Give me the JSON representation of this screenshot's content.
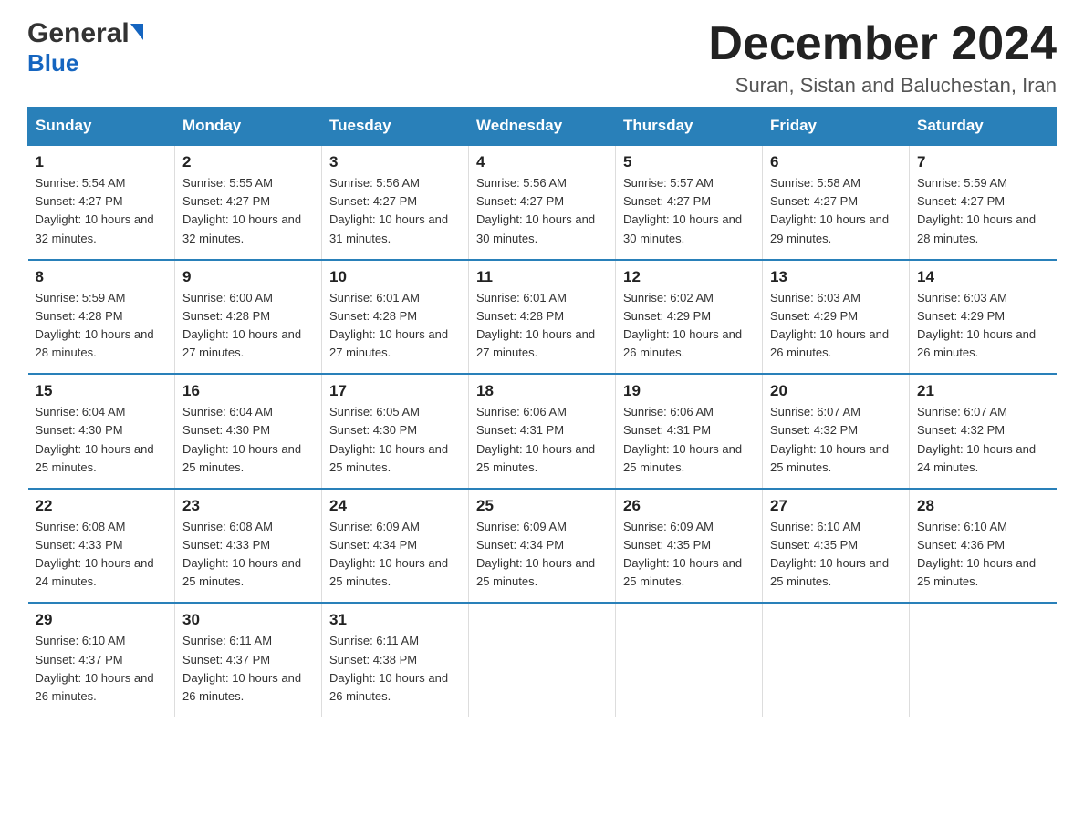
{
  "header": {
    "logo_general": "General",
    "logo_blue": "Blue",
    "month_title": "December 2024",
    "subtitle": "Suran, Sistan and Baluchestan, Iran"
  },
  "days_of_week": [
    "Sunday",
    "Monday",
    "Tuesday",
    "Wednesday",
    "Thursday",
    "Friday",
    "Saturday"
  ],
  "weeks": [
    [
      {
        "day": "1",
        "sunrise": "5:54 AM",
        "sunset": "4:27 PM",
        "daylight": "10 hours and 32 minutes."
      },
      {
        "day": "2",
        "sunrise": "5:55 AM",
        "sunset": "4:27 PM",
        "daylight": "10 hours and 32 minutes."
      },
      {
        "day": "3",
        "sunrise": "5:56 AM",
        "sunset": "4:27 PM",
        "daylight": "10 hours and 31 minutes."
      },
      {
        "day": "4",
        "sunrise": "5:56 AM",
        "sunset": "4:27 PM",
        "daylight": "10 hours and 30 minutes."
      },
      {
        "day": "5",
        "sunrise": "5:57 AM",
        "sunset": "4:27 PM",
        "daylight": "10 hours and 30 minutes."
      },
      {
        "day": "6",
        "sunrise": "5:58 AM",
        "sunset": "4:27 PM",
        "daylight": "10 hours and 29 minutes."
      },
      {
        "day": "7",
        "sunrise": "5:59 AM",
        "sunset": "4:27 PM",
        "daylight": "10 hours and 28 minutes."
      }
    ],
    [
      {
        "day": "8",
        "sunrise": "5:59 AM",
        "sunset": "4:28 PM",
        "daylight": "10 hours and 28 minutes."
      },
      {
        "day": "9",
        "sunrise": "6:00 AM",
        "sunset": "4:28 PM",
        "daylight": "10 hours and 27 minutes."
      },
      {
        "day": "10",
        "sunrise": "6:01 AM",
        "sunset": "4:28 PM",
        "daylight": "10 hours and 27 minutes."
      },
      {
        "day": "11",
        "sunrise": "6:01 AM",
        "sunset": "4:28 PM",
        "daylight": "10 hours and 27 minutes."
      },
      {
        "day": "12",
        "sunrise": "6:02 AM",
        "sunset": "4:29 PM",
        "daylight": "10 hours and 26 minutes."
      },
      {
        "day": "13",
        "sunrise": "6:03 AM",
        "sunset": "4:29 PM",
        "daylight": "10 hours and 26 minutes."
      },
      {
        "day": "14",
        "sunrise": "6:03 AM",
        "sunset": "4:29 PM",
        "daylight": "10 hours and 26 minutes."
      }
    ],
    [
      {
        "day": "15",
        "sunrise": "6:04 AM",
        "sunset": "4:30 PM",
        "daylight": "10 hours and 25 minutes."
      },
      {
        "day": "16",
        "sunrise": "6:04 AM",
        "sunset": "4:30 PM",
        "daylight": "10 hours and 25 minutes."
      },
      {
        "day": "17",
        "sunrise": "6:05 AM",
        "sunset": "4:30 PM",
        "daylight": "10 hours and 25 minutes."
      },
      {
        "day": "18",
        "sunrise": "6:06 AM",
        "sunset": "4:31 PM",
        "daylight": "10 hours and 25 minutes."
      },
      {
        "day": "19",
        "sunrise": "6:06 AM",
        "sunset": "4:31 PM",
        "daylight": "10 hours and 25 minutes."
      },
      {
        "day": "20",
        "sunrise": "6:07 AM",
        "sunset": "4:32 PM",
        "daylight": "10 hours and 25 minutes."
      },
      {
        "day": "21",
        "sunrise": "6:07 AM",
        "sunset": "4:32 PM",
        "daylight": "10 hours and 24 minutes."
      }
    ],
    [
      {
        "day": "22",
        "sunrise": "6:08 AM",
        "sunset": "4:33 PM",
        "daylight": "10 hours and 24 minutes."
      },
      {
        "day": "23",
        "sunrise": "6:08 AM",
        "sunset": "4:33 PM",
        "daylight": "10 hours and 25 minutes."
      },
      {
        "day": "24",
        "sunrise": "6:09 AM",
        "sunset": "4:34 PM",
        "daylight": "10 hours and 25 minutes."
      },
      {
        "day": "25",
        "sunrise": "6:09 AM",
        "sunset": "4:34 PM",
        "daylight": "10 hours and 25 minutes."
      },
      {
        "day": "26",
        "sunrise": "6:09 AM",
        "sunset": "4:35 PM",
        "daylight": "10 hours and 25 minutes."
      },
      {
        "day": "27",
        "sunrise": "6:10 AM",
        "sunset": "4:35 PM",
        "daylight": "10 hours and 25 minutes."
      },
      {
        "day": "28",
        "sunrise": "6:10 AM",
        "sunset": "4:36 PM",
        "daylight": "10 hours and 25 minutes."
      }
    ],
    [
      {
        "day": "29",
        "sunrise": "6:10 AM",
        "sunset": "4:37 PM",
        "daylight": "10 hours and 26 minutes."
      },
      {
        "day": "30",
        "sunrise": "6:11 AM",
        "sunset": "4:37 PM",
        "daylight": "10 hours and 26 minutes."
      },
      {
        "day": "31",
        "sunrise": "6:11 AM",
        "sunset": "4:38 PM",
        "daylight": "10 hours and 26 minutes."
      },
      null,
      null,
      null,
      null
    ]
  ],
  "labels": {
    "sunrise": "Sunrise:",
    "sunset": "Sunset:",
    "daylight": "Daylight:"
  }
}
